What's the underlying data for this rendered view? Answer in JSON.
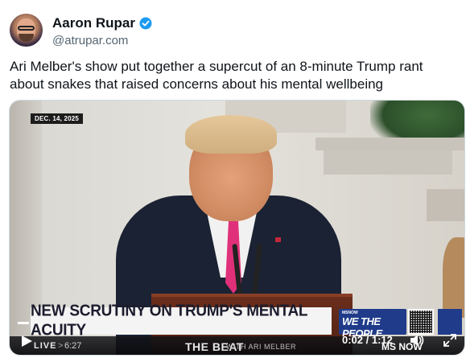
{
  "author": {
    "name": "Aaron Rupar",
    "handle": "@atrupar.com",
    "verified": true,
    "accent_color": "#1d9bf0"
  },
  "post": {
    "text": "Ari Melber's show put together a supercut of an 8-minute Trump rant about snakes that raised concerns about his mental wellbeing"
  },
  "video": {
    "date_badge": "DEC. 14, 2025",
    "headline": "NEW SCRUTINY ON TRUMP'S MENTAL ACUITY",
    "bug_top": "MSNOW",
    "bug_title": "WE THE PEOPLE",
    "ticker": {
      "live_label": "LIVE",
      "time": "6:27",
      "show_name": "THE BEAT",
      "show_sub": "WITH ARI MELBER",
      "network": "MS NOW"
    },
    "player": {
      "current_time": "0:02",
      "duration": "1:12",
      "time_display": "0:02 / 1:12",
      "play_icon": "play-icon",
      "volume_icon": "volume-icon",
      "fullscreen_icon": "fullscreen-icon"
    }
  }
}
